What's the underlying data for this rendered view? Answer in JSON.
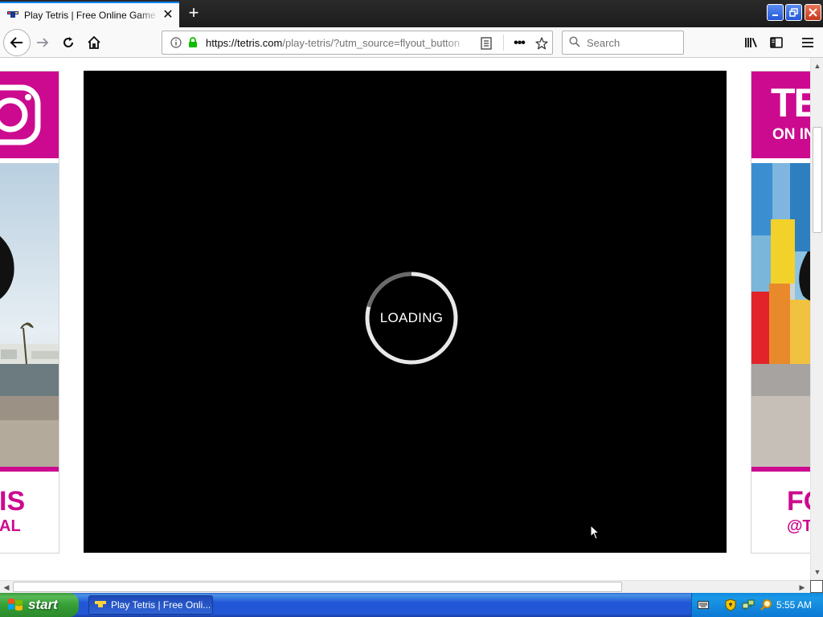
{
  "browser": {
    "tab_title": "Play Tetris | Free Online Game | Tetris",
    "url_host": "https://tetris.com",
    "url_rest": "/play-tetris/?utm_source=flyout_button",
    "search_placeholder": "Search"
  },
  "ads": {
    "left": {
      "line1": "IS",
      "line2": "AL"
    },
    "right": {
      "brand1": "TETRIS",
      "brand2": "ON IN",
      "line1": "FO",
      "line2": "@TE"
    }
  },
  "game": {
    "loading_label": "LOADING"
  },
  "taskbar": {
    "start_label": "start",
    "task_label": "Play Tetris | Free Onli...",
    "clock": "5:55 AM"
  },
  "colors": {
    "brand_pink": "#cc0a8f",
    "accent_blue": "#0a84ff",
    "lock_green": "#12bc00"
  }
}
